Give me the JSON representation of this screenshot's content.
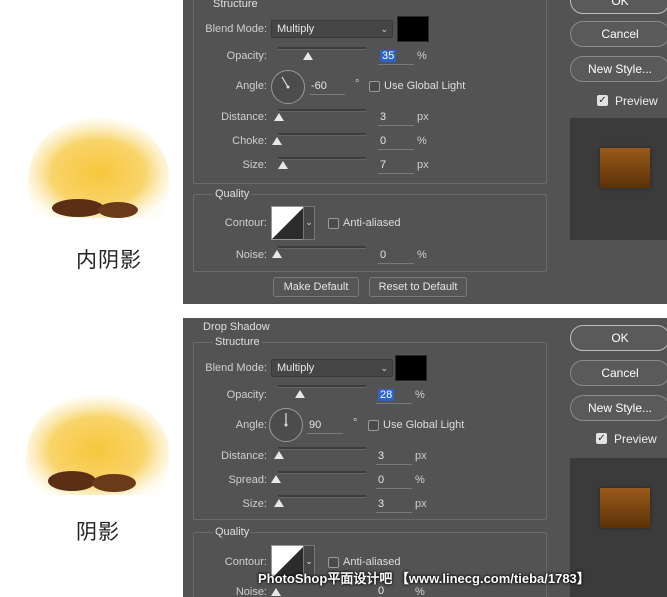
{
  "top": {
    "illustration_label": "内阴影",
    "section_title": "Structure",
    "blend_mode_label": "Blend Mode:",
    "blend_mode_value": "Multiply",
    "opacity_label": "Opacity:",
    "opacity_value": "35",
    "opacity_unit": "%",
    "opacity_level": 35,
    "angle_label": "Angle:",
    "angle_value": "-60",
    "angle_unit": "°",
    "use_global_light_label": "Use Global Light",
    "distance_label": "Distance:",
    "distance_value": "3",
    "distance_unit": "px",
    "choke_label": "Choke:",
    "choke_value": "0",
    "choke_unit": "%",
    "size_label": "Size:",
    "size_value": "7",
    "size_unit": "px",
    "quality_title": "Quality",
    "contour_label": "Contour:",
    "anti_aliased_label": "Anti-aliased",
    "noise_label": "Noise:",
    "noise_value": "0",
    "noise_unit": "%",
    "make_default_label": "Make Default",
    "reset_default_label": "Reset to Default",
    "ok_label": "OK",
    "cancel_label": "Cancel",
    "new_style_label": "New Style...",
    "preview_label": "Preview"
  },
  "bottom": {
    "illustration_label": "阴影",
    "panel_title": "Drop Shadow",
    "section_title": "Structure",
    "blend_mode_label": "Blend Mode:",
    "blend_mode_value": "Multiply",
    "opacity_label": "Opacity:",
    "opacity_value": "28",
    "opacity_unit": "%",
    "opacity_level": 28,
    "angle_label": "Angle:",
    "angle_value": "90",
    "angle_unit": "°",
    "use_global_light_label": "Use Global Light",
    "distance_label": "Distance:",
    "distance_value": "3",
    "distance_unit": "px",
    "spread_label": "Spread:",
    "spread_value": "0",
    "spread_unit": "%",
    "size_label": "Size:",
    "size_value": "3",
    "size_unit": "px",
    "quality_title": "Quality",
    "contour_label": "Contour:",
    "anti_aliased_label": "Anti-aliased",
    "noise_label": "Noise:",
    "noise_value": "0",
    "noise_unit": "%",
    "ok_label": "OK",
    "cancel_label": "Cancel",
    "new_style_label": "New Style...",
    "preview_label": "Preview"
  },
  "watermark": "PhotoShop平面设计吧 【www.linecg.com/tieba/1783】",
  "colors": {
    "panel_bg": "#535353",
    "swatch": "#000000",
    "selection": "#2d63c9",
    "preview_brown": "#7a4512",
    "fur_yellow": "#f5c84a"
  },
  "icons": {
    "blend_dropdown": "chevron-down-icon",
    "check": "checkmark-icon",
    "contour_dropdown": "chevron-down-icon"
  }
}
